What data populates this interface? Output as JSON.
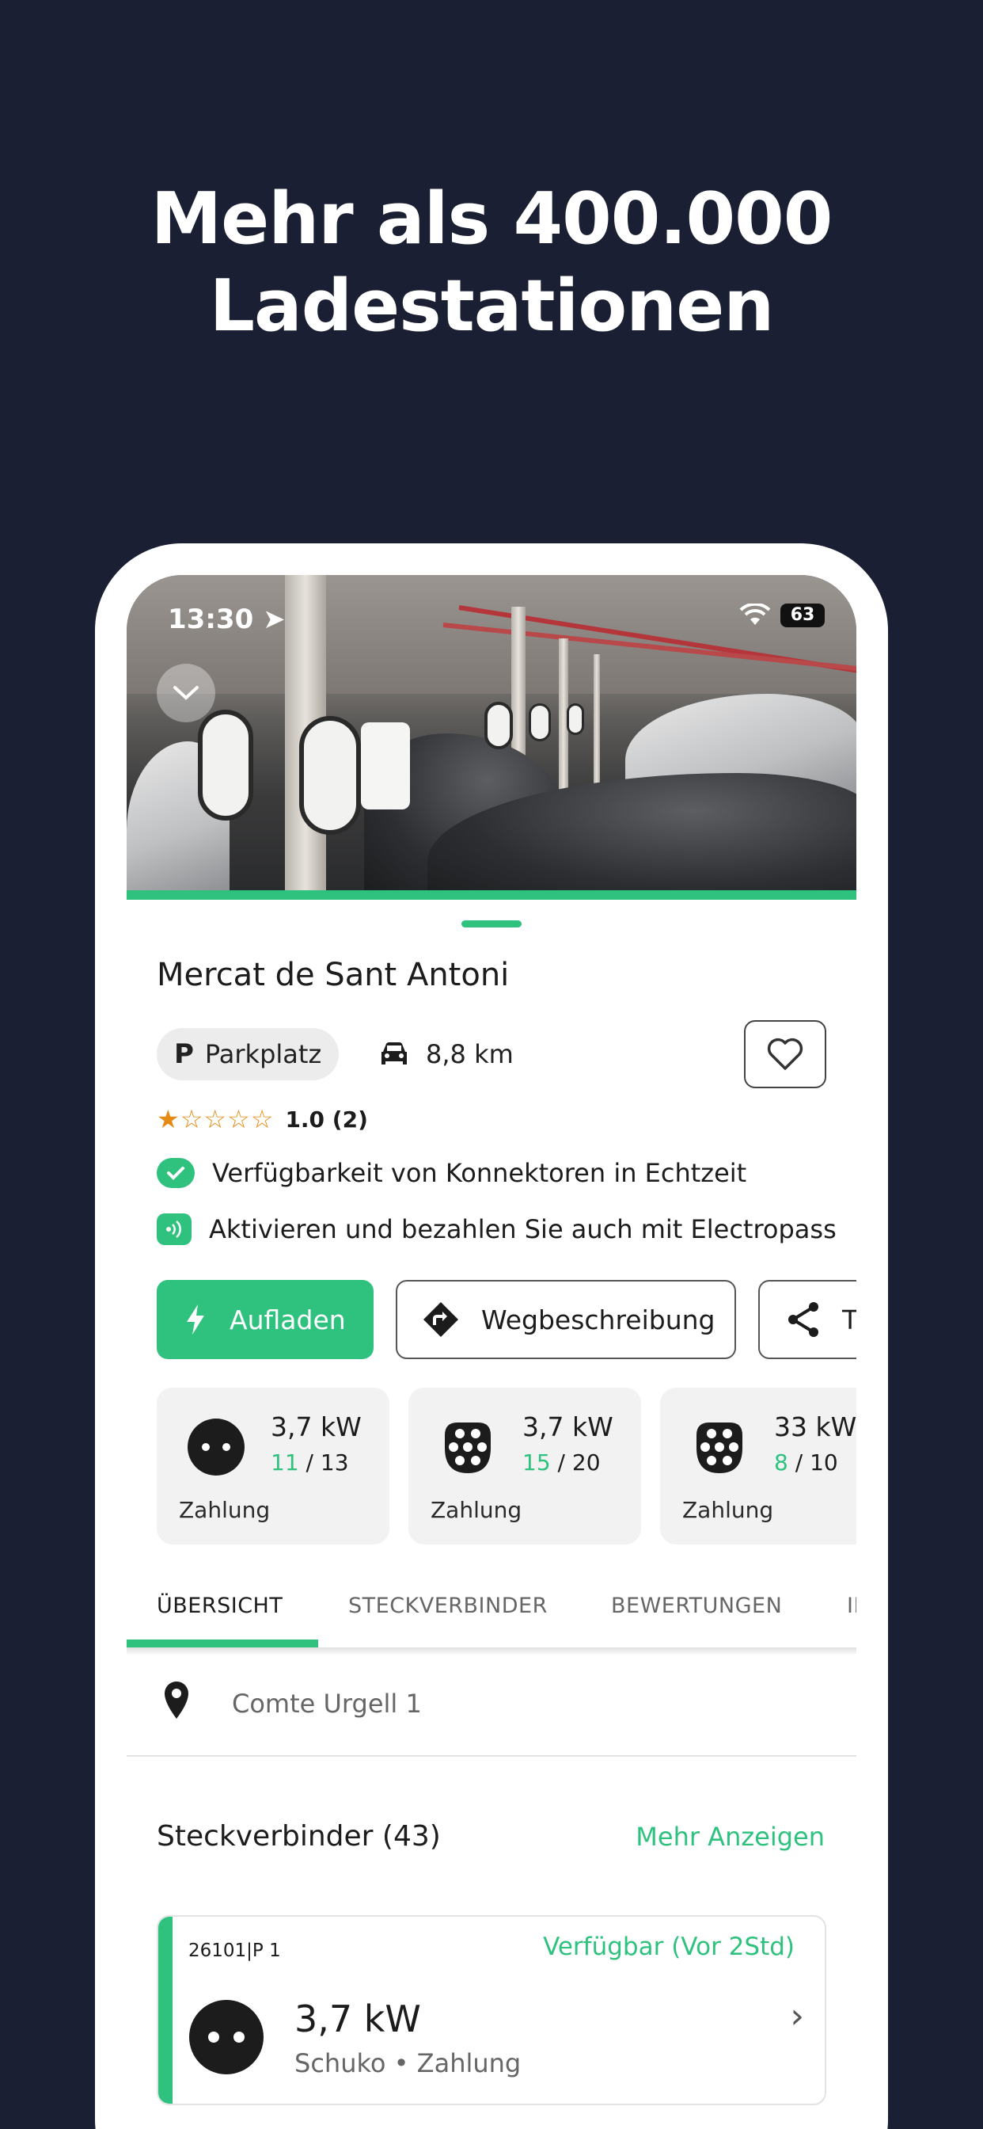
{
  "headline": {
    "line1": "Mehr als 400.000",
    "line2": "Ladestationen"
  },
  "status_bar": {
    "time": "13:30",
    "battery": "63"
  },
  "station": {
    "name": "Mercat de Sant Antoni",
    "parking_icon": "P",
    "parking_label": "Parkplatz",
    "distance": "8,8 km",
    "rating_stars": 1,
    "rating_text": "1.0 (2)"
  },
  "features": [
    {
      "icon": "cloud-check-icon",
      "text": "Verfügbarkeit von Konnektoren in Echtzeit"
    },
    {
      "icon": "contactless-icon",
      "text": "Aktivieren und bezahlen Sie auch mit Electropass"
    }
  ],
  "actions": {
    "charge": "Aufladen",
    "directions": "Wegbeschreibung",
    "share": "T"
  },
  "connectors": [
    {
      "icon": "schuko-plug-icon",
      "power": "3,7 kW",
      "available": "11",
      "total": "/ 13",
      "payment": "Zahlung"
    },
    {
      "icon": "type2-plug-icon",
      "power": "3,7 kW",
      "available": "15",
      "total": "/ 20",
      "payment": "Zahlung"
    },
    {
      "icon": "type2-plug-icon",
      "power": "33 kW",
      "available": "8",
      "total": "/ 10",
      "payment": "Zahlung"
    }
  ],
  "tabs": [
    "ÜBERSICHT",
    "STECKVERBINDER",
    "BEWERTUNGEN",
    "IN"
  ],
  "address": "Comte Urgell 1",
  "section": {
    "title": "Steckverbinder (43)",
    "more": "Mehr Anzeigen"
  },
  "plug": {
    "id": "26101|P 1",
    "status": "Verfügbar",
    "status_time": "(Vor 2Std)",
    "power": "3,7 kW",
    "type": "Schuko • Zahlung"
  },
  "colors": {
    "background": "#1b1f33",
    "accent": "#2fc27f",
    "star": "#e58a12"
  }
}
